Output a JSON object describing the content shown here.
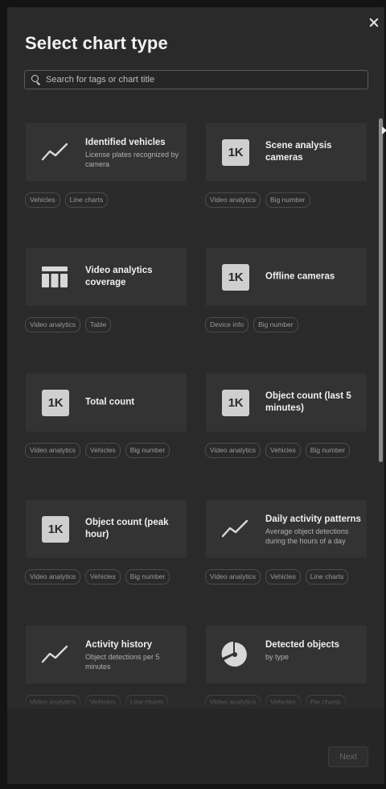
{
  "dialog": {
    "title": "Select chart type",
    "search_placeholder": "Search for tags or chart title",
    "next_label": "Next"
  },
  "cards": [
    {
      "title": "Identified vehicles",
      "subtitle": "License plates recognized by camera",
      "icon": "line-chart-icon",
      "tags": [
        "Vehicles",
        "Line charts"
      ]
    },
    {
      "title": "Scene analysis cameras",
      "subtitle": "",
      "icon": "big-number-icon",
      "icon_text": "1K",
      "tags": [
        "Video analytics",
        "Big number"
      ]
    },
    {
      "title": "Video analytics coverage",
      "subtitle": "",
      "icon": "table-icon",
      "tags": [
        "Video analytics",
        "Table"
      ]
    },
    {
      "title": "Offline cameras",
      "subtitle": "",
      "icon": "big-number-icon",
      "icon_text": "1K",
      "tags": [
        "Device info",
        "Big number"
      ]
    },
    {
      "title": "Total count",
      "subtitle": "",
      "icon": "big-number-icon",
      "icon_text": "1K",
      "tags": [
        "Video analytics",
        "Vehicles",
        "Big number"
      ]
    },
    {
      "title": "Object count (last 5 minutes)",
      "subtitle": "",
      "icon": "big-number-icon",
      "icon_text": "1K",
      "tags": [
        "Video analytics",
        "Vehicles",
        "Big number"
      ]
    },
    {
      "title": "Object count (peak hour)",
      "subtitle": "",
      "icon": "big-number-icon",
      "icon_text": "1K",
      "tags": [
        "Video analytics",
        "Vehicles",
        "Big number"
      ]
    },
    {
      "title": "Daily activity patterns",
      "subtitle": "Average object detections during the hours of a day",
      "icon": "line-chart-icon",
      "tags": [
        "Video analytics",
        "Vehicles",
        "Line charts"
      ]
    },
    {
      "title": "Activity history",
      "subtitle": "Object detections per 5 minutes",
      "icon": "line-chart-icon",
      "tags": [
        "Video analytics",
        "Vehicles",
        "Line charts"
      ]
    },
    {
      "title": "Detected objects",
      "subtitle": "by type",
      "icon": "pie-chart-icon",
      "tags": [
        "Video analytics",
        "Vehicles",
        "Pie charts"
      ]
    }
  ],
  "colors": {
    "panel": "#2a2a2a",
    "card": "#333333",
    "badge": "#cfcfcf"
  }
}
